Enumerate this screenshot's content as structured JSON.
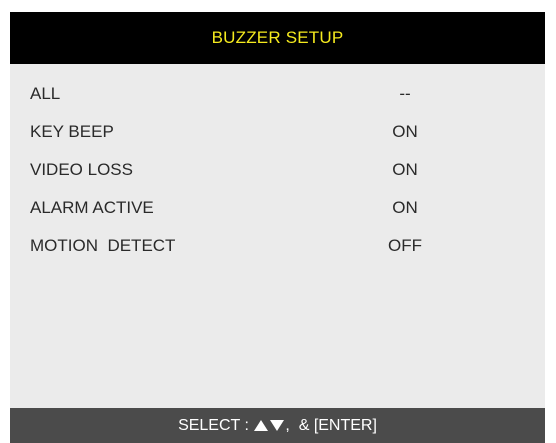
{
  "title": "BUZZER SETUP",
  "colors": {
    "title_text": "#f5ea1e",
    "title_bar": "#000000",
    "panel_bg": "#ebebeb",
    "footer_bg": "#4b4b4b"
  },
  "items": [
    {
      "label": "ALL",
      "value": "--"
    },
    {
      "label": "KEY BEEP",
      "value": "ON"
    },
    {
      "label": "VIDEO LOSS",
      "value": "ON"
    },
    {
      "label": "ALARM ACTIVE",
      "value": "ON"
    },
    {
      "label": "MOTION  DETECT",
      "value": "OFF"
    }
  ],
  "footer": {
    "select_label": "SELECT : ",
    "arrow_up_icon": "triangle-up-icon",
    "arrow_down_icon": "triangle-down-icon",
    "enter_label": ",  & [ENTER]"
  }
}
